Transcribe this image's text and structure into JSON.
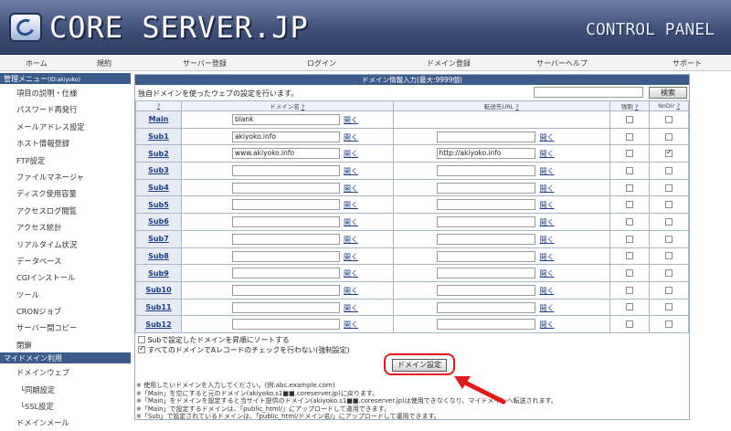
{
  "header": {
    "logo": "CORE SERVER.JP",
    "panel": "CONTROL PANEL"
  },
  "topnav": [
    "ホーム",
    "規約",
    "サーバー登録",
    "ログイン",
    "ドメイン登録",
    "サーバーヘルプ",
    "サポート"
  ],
  "sidebar": {
    "head1": "管理メニュー",
    "head1_id": "(ID:akiyoko)",
    "items": [
      "項目の説明・仕様",
      "パスワード再発行",
      "メールアドレス設定",
      "ホスト情報登録",
      "FTP設定",
      "ファイルマネージャ",
      "ディスク使用容量",
      "アクセスログ閲覧",
      "アクセス統計",
      "リアルタイム状況",
      "データベース",
      "CGIインストール",
      "ツール",
      "CRONジョブ",
      "サーバー間コピー",
      "閉鎖"
    ],
    "head2": "マイドメイン利用",
    "items2": [
      "ドメインウェブ",
      "└同期設定",
      "└SSL設定",
      "ドメインメール"
    ]
  },
  "main": {
    "title": "ドメイン情報入力(最大:9999個)",
    "intro": "独自ドメインを使ったウェブの設定を行います。",
    "search_button": "検索",
    "col_q": "?",
    "col_domain": "ドメイン名",
    "col_forward": "転送先URL",
    "col_force": "強制",
    "col_nodir": "NoDir",
    "open_label": "開く",
    "rows": [
      {
        "label": "Main",
        "domain": "blank",
        "forward": "",
        "force": false,
        "nodir": false,
        "has_forward": false
      },
      {
        "label": "Sub1",
        "domain": "akiyoko.info",
        "forward": "",
        "force": false,
        "nodir": false,
        "has_forward": true
      },
      {
        "label": "Sub2",
        "domain": "www.akiyoko.info",
        "forward": "http://akiyoko.info",
        "force": false,
        "nodir": true,
        "has_forward": true
      },
      {
        "label": "Sub3",
        "domain": "",
        "forward": "",
        "force": false,
        "nodir": false,
        "has_forward": true
      },
      {
        "label": "Sub4",
        "domain": "",
        "forward": "",
        "force": false,
        "nodir": false,
        "has_forward": true
      },
      {
        "label": "Sub5",
        "domain": "",
        "forward": "",
        "force": false,
        "nodir": false,
        "has_forward": true
      },
      {
        "label": "Sub6",
        "domain": "",
        "forward": "",
        "force": false,
        "nodir": false,
        "has_forward": true
      },
      {
        "label": "Sub7",
        "domain": "",
        "forward": "",
        "force": false,
        "nodir": false,
        "has_forward": true
      },
      {
        "label": "Sub8",
        "domain": "",
        "forward": "",
        "force": false,
        "nodir": false,
        "has_forward": true
      },
      {
        "label": "Sub9",
        "domain": "",
        "forward": "",
        "force": false,
        "nodir": false,
        "has_forward": true
      },
      {
        "label": "Sub10",
        "domain": "",
        "forward": "",
        "force": false,
        "nodir": false,
        "has_forward": true
      },
      {
        "label": "Sub11",
        "domain": "",
        "forward": "",
        "force": false,
        "nodir": false,
        "has_forward": true
      },
      {
        "label": "Sub12",
        "domain": "",
        "forward": "",
        "force": false,
        "nodir": false,
        "has_forward": true
      }
    ],
    "opt1": "Subで設定したドメインを昇順にソートする",
    "opt1_checked": false,
    "opt2": "すべてのドメインでAレコードのチェックを行わない(強制設定)",
    "opt2_checked": true,
    "submit": "ドメイン設定",
    "notes": [
      "※ 使用したいドメインを入力してください。(例:abc.example.com)",
      "※「Main」を空にすると元のドメイン(akiyoko.s1■■.coreserver.jp)に戻ります。",
      "※「Main」をドメインを設定すると当サイト提供のドメイン(akiyoko.s1■■.coreserver.jp)は使用できなくなり、マイドメインへ転送されます。",
      "※「Main」で設定するドメインは、「public_html/」にアップロードして運用できます。",
      "※「Sub」で設定されているドメインは、「public_html/ドメイン名/」にアップロードして運用できます。"
    ]
  },
  "colors": {
    "accent": "#3d5b8a",
    "highlight": "#e41919"
  }
}
